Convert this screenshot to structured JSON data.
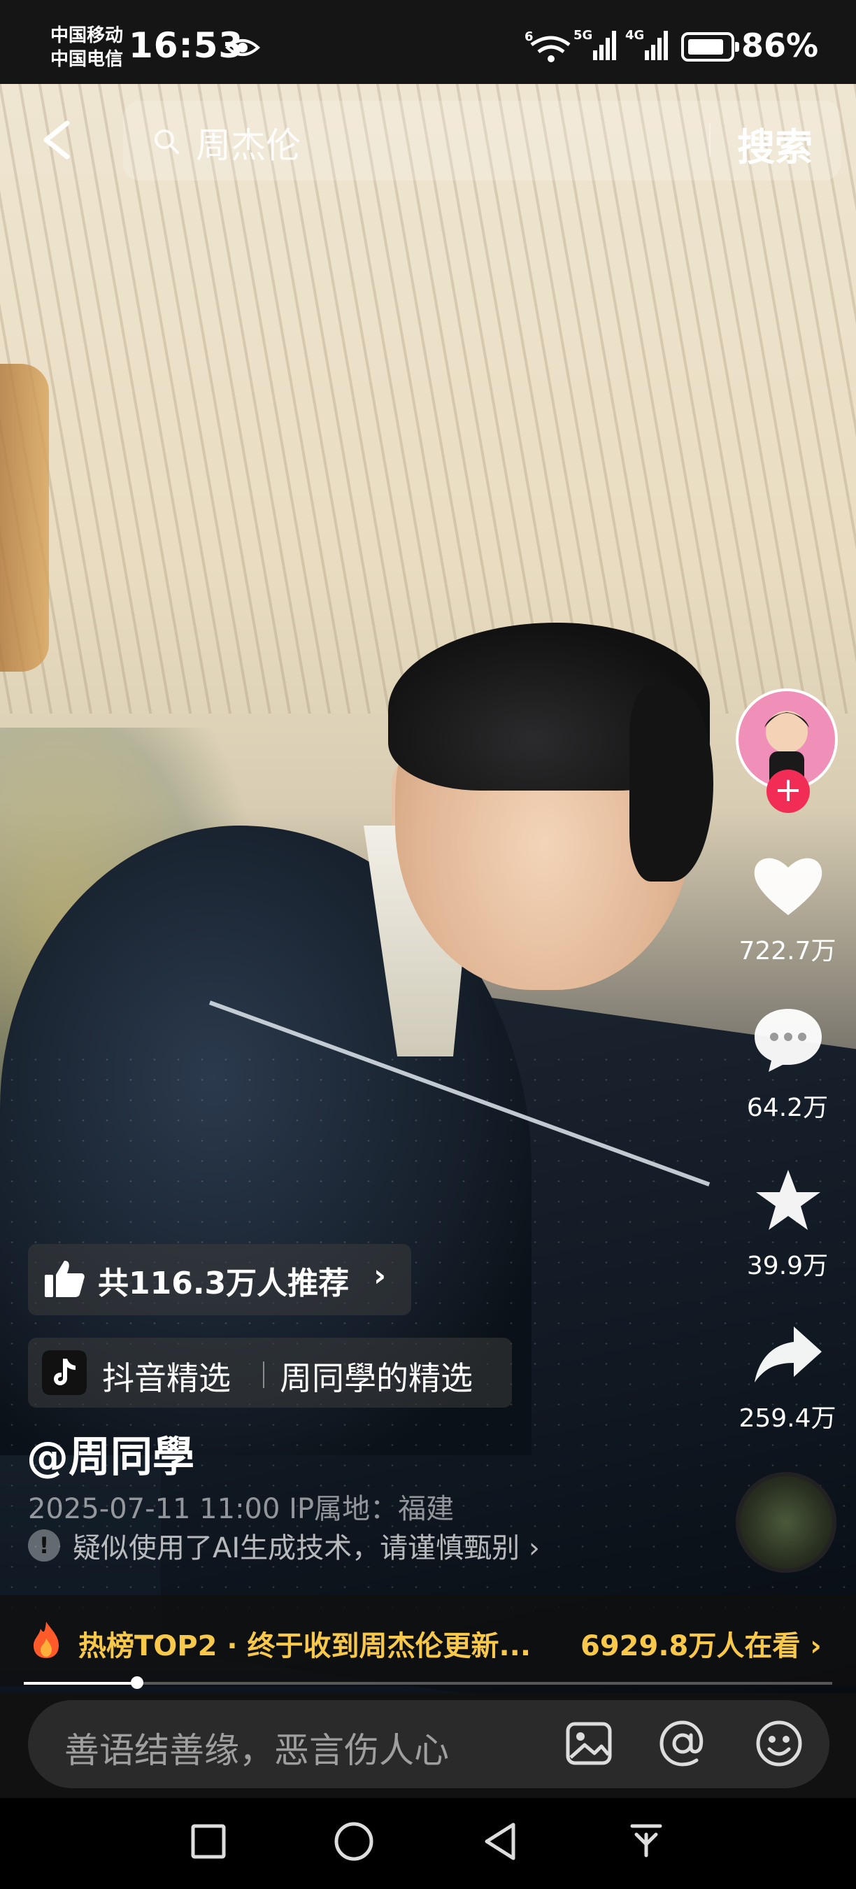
{
  "status_bar": {
    "carrier_1": "中国移动",
    "carrier_2": "中国电信",
    "time": "16:53",
    "signal_labels": [
      "6",
      "5G",
      "4G"
    ],
    "battery_percent": 86,
    "battery_text": "86%",
    "icons": [
      "eye-icon",
      "wifi-icon",
      "signal-5g-icon",
      "signal-4g-icon",
      "battery-icon"
    ]
  },
  "search": {
    "query": "周杰伦",
    "button": "搜索"
  },
  "right_rail": {
    "like_count": "722.7万",
    "comment_count": "64.2万",
    "favorite_count": "39.9万",
    "share_count": "259.4万",
    "icons": [
      "avatar",
      "follow-plus-icon",
      "heart-icon",
      "comment-icon",
      "star-icon",
      "share-icon",
      "music-disc"
    ]
  },
  "video_info": {
    "recommend_text": "共116.3万人推荐",
    "chevron": "›",
    "collection_source": "抖音精选",
    "collection_name": "周同學的精选",
    "author": "@周同學",
    "date_location": "2025-07-11 11:00  IP属地：福建",
    "ai_warning": "疑似使用了AI生成技术，请谨慎甄别 ›"
  },
  "hot": {
    "text": "热榜TOP2 · 终于收到周杰伦更新...",
    "watching": "6929.8万人在看 ›"
  },
  "playback": {
    "progress_fraction": 0.14
  },
  "comment": {
    "placeholder": "善语结善缘，恶言伤人心",
    "icons": [
      "image-icon",
      "at-icon",
      "emoji-icon"
    ]
  },
  "nav": {
    "icons": [
      "recents-square-icon",
      "home-circle-icon",
      "back-triangle-icon",
      "notification-pull-icon"
    ]
  },
  "colors": {
    "hot_accent": "#f8c84b",
    "follow_red": "#f22d55",
    "avatar_pink": "#f090b8"
  }
}
